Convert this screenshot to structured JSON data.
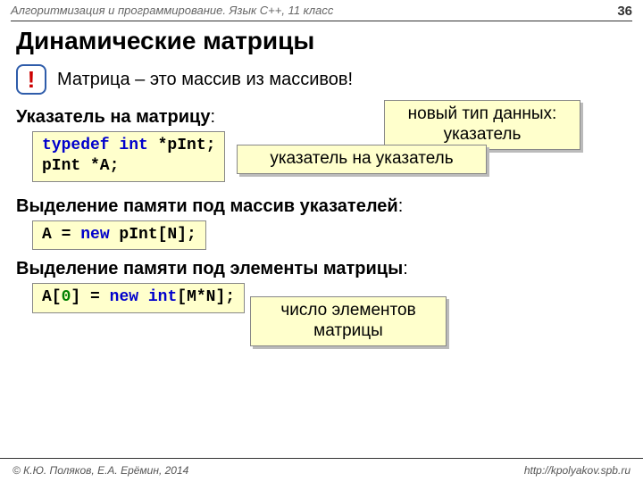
{
  "header": {
    "subject": "Алгоритмизация и программирование. Язык C++, 11 класс",
    "page": "36"
  },
  "title": "Динамические матрицы",
  "info": {
    "mark": "!",
    "text": "Матрица – это массив из массивов!"
  },
  "s1": {
    "label": "Указатель на матрицу",
    "colon": ":",
    "code": {
      "l1_kw": "typedef int",
      "l1_rest": " *pInt;",
      "l2": "pInt *A;"
    },
    "call1": {
      "a": "новый тип данных:",
      "b": "указатель"
    },
    "call2": "указатель на указатель"
  },
  "s2": {
    "label": "Выделение памяти под массив указателей",
    "colon": ":",
    "code": {
      "a": "A",
      "eq": " = ",
      "kw": "new",
      "rest": " pInt[N];"
    }
  },
  "s3": {
    "label": "Выделение памяти под элементы матрицы",
    "colon": ":",
    "code": {
      "a": "A[",
      "idx": "0",
      "b": "]",
      "eq": " = ",
      "kw": "new int",
      "rest": "[M*N];"
    },
    "call3": {
      "a": "число элементов",
      "b": "матрицы"
    }
  },
  "footer": {
    "left": "© К.Ю. Поляков, Е.А. Ерёмин, 2014",
    "right": "http://kpolyakov.spb.ru"
  }
}
